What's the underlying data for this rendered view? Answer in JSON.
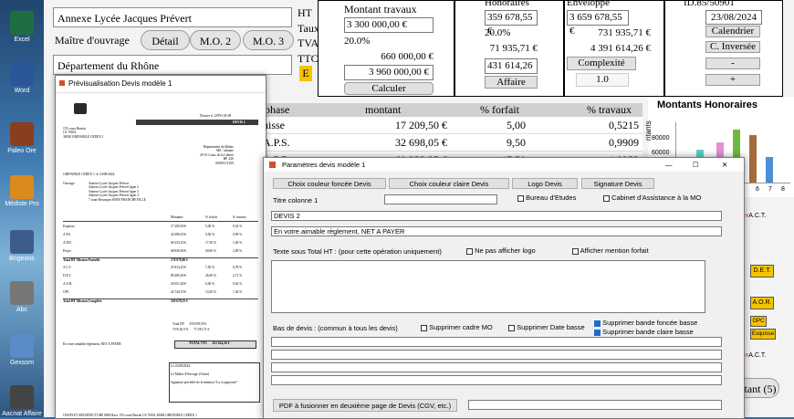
{
  "desktop": {
    "icons": [
      {
        "label": "Excel",
        "color": "#1d6f42"
      },
      {
        "label": "Word",
        "color": "#2b579a"
      },
      {
        "label": "Paleo Ore",
        "color": "#8a3d1f"
      },
      {
        "label": "Médiste Pro",
        "color": "#d98b1e"
      },
      {
        "label": "Brigeons",
        "color": "#3e5c8a"
      },
      {
        "label": "Abc",
        "color": "#777777"
      },
      {
        "label": "Gexsom",
        "color": "#5b8bc8"
      },
      {
        "label": "Aacnat Affaire",
        "color": "#444444"
      }
    ]
  },
  "main": {
    "annexe_field": "Annexe Lycée Jacques Prévert",
    "maitre_label": "Maître d'ouvrage",
    "btn_detail": "Détail",
    "btn_mo2": "M.O. 2",
    "btn_mo3": "M.O. 3",
    "departement_field": "Département du Rhône",
    "side_labels": [
      "HT",
      "Taux",
      "TVA",
      "TTC",
      "E"
    ],
    "montant_travaux_label": "Montant travaux",
    "montant_value": "3 300 000,00 €",
    "taux_value": "20.0%",
    "tva_value": "660 000,00 €",
    "ttc_value": "3 960 000,00 €",
    "btn_calculer": "Calculer",
    "honoraires_label": "Honoraires",
    "hon_ht": "359 678,55 €",
    "hon_taux": "20.0%",
    "hon_tva": "71 935,71 €",
    "hon_ttc": "431 614,26 €",
    "btn_affaire": "Affaire",
    "enveloppe_label": "Enveloppe",
    "env_ht": "3 659 678,55 €",
    "env_tva": "731 935,71 €",
    "env_ttc": "4 391 614,26 €",
    "btn_complexite": "Complexité",
    "complexite_value": "1.0",
    "id_label": "ID.85/50901",
    "date_value": "23/08/2024",
    "btn_calendrier": "Calendrier",
    "btn_c_inversee": "C. Inversée",
    "btn_minus": "-",
    "btn_plus": "+",
    "table_headers": [
      "phase",
      "montant",
      "% forfait",
      "% travaux"
    ],
    "table_rows": [
      {
        "phase": "uisse",
        "montant": "17 209,50 €",
        "forfait": "5,00",
        "travaux": "0,5215"
      },
      {
        "phase": "A.P.S.",
        "montant": "32 698,05 €",
        "forfait": "9,50",
        "travaux": "0,9909"
      },
      {
        "phase": "A.P.D.",
        "montant": "60 233,25 €",
        "forfait": "17,50",
        "travaux": "1,8253"
      }
    ],
    "chart_title": "Montants Honoraires",
    "chart_ylabel": "ntants",
    "chart_ticks_y": [
      "80000",
      "60000"
    ],
    "chart_ticks_x": [
      "6",
      "7",
      "8"
    ],
    "right_tags": [
      "A.C.T.",
      "D.E.T.",
      "A.O.R.",
      "OPC",
      "Esquisse",
      "A.C.T."
    ],
    "btn_montant": "ntant (5)"
  },
  "preview": {
    "title": "Prévisualisation Devis modèle 1",
    "lines": {
      "company_small": "155 cours Berriat\nCS 70032\n38028 GRENOBLE CEDEX 1",
      "dossier": "Dossier n° 2079-CD-09",
      "devis_heading": "DEVIS 2",
      "client": "Département du Rhône\nSEI / urbaine\n29-31 Cours de la Liberté\nBP. 226\n69003 LYON",
      "city_date": "GRENOBLE CEDEX 1, le 23/08/2024",
      "objet_label": "Ouvrage :",
      "objet": "Annexe Lycée Jacques Prévert\nAnnexe Lycée Jacques Prévert ligne 2\nAnnexe Lycée Jacques Prévert ligne 3\nAnnexe Lycée Jacques Prévert ligne 4\n7 route Besançon 69300 FRANCHEVILLE",
      "col_headers": [
        "Montants",
        "% forfait",
        "% travaux"
      ],
      "rows": [
        [
          "Esquisse",
          "17 209,50 €",
          "5,00 %",
          "0,52 %"
        ],
        [
          "A.P.S.",
          "32 698,05 €",
          "9,50 %",
          "0,99 %"
        ],
        [
          "A.P.D.",
          "60 233,25 €",
          "17,50 %",
          "1,83 %"
        ],
        [
          "Projet",
          "68 830,00 €",
          "20,00 %",
          "2,09 %"
        ],
        [
          "Total HT Mission Partielle",
          "178 970,80 €",
          "",
          ""
        ],
        [
          "A.C.T.",
          "25 814,25 €",
          "7,50 %",
          "0,78 %"
        ],
        [
          "D.E.T.",
          "89 489,40 €",
          "26,00 %",
          "2,71 %"
        ],
        [
          "A.O.R.",
          "20 651,40 €",
          "6,00 %",
          "0,63 %"
        ],
        [
          "OPC",
          "44 744,70 €",
          "13,00 %",
          "1,36 %"
        ],
        [
          "Total HT Mission Complète",
          "359 678,55 €",
          "",
          ""
        ]
      ],
      "total_ht": "Total HT      359 678,55 €",
      "tva": "TVA 20.0 %      71 935,71 €",
      "reglement": "En votre aimable règlement, NET A PAYER",
      "total_ttc": "TOTAL TTC      431 614,26 €",
      "signature": "Le 23/08/2024\n\nLe Maître d'Ouvrage (Client)\n\nSignature précédée de la mention \"Lu et approuvé\"",
      "footer": "CHAPLET ARCHITECTURE 8006 Race 155 cours Berriat CS 70032 38028 GRENOBLE CEDEX 1"
    }
  },
  "dialog": {
    "title": "Paramètres devis modèle 1",
    "btn_fonce": "Choix couleur foncée Devis",
    "btn_claire": "Choix couleur claire Devis",
    "btn_logo": "Logo Devis",
    "btn_signature": "Signature Devis",
    "titre_col_label": "Titre colonne 1",
    "titre_col_value": "",
    "bureau_label": "Bureau d'Etudes",
    "cabinet_label": "Cabinet d'Assistance à la MO",
    "devis_value": "DEVIS 2",
    "reglement_value": "En votre aimable règlement, NET A PAYER",
    "texte_sous_label": "Texte sous Total HT  : (pour cette opération uniquement)",
    "ne_pas_logo": "Ne pas afficher logo",
    "afficher_forfait": "Afficher mention forfait",
    "bas_devis_label": "Bas de devis : (commun à tous les devis)",
    "suppr_cadre": "Supprimer cadre MO",
    "suppr_date": "Supprimer Date basse",
    "suppr_fonce": "Supprimer bande foncée basse",
    "suppr_claire": "Supprimer bande claire basse",
    "btn_pdf": "PDF à fusionner en deuxième page de Devis (CGV, etc.)",
    "win_controls": [
      "—",
      "☐",
      "✕"
    ]
  }
}
